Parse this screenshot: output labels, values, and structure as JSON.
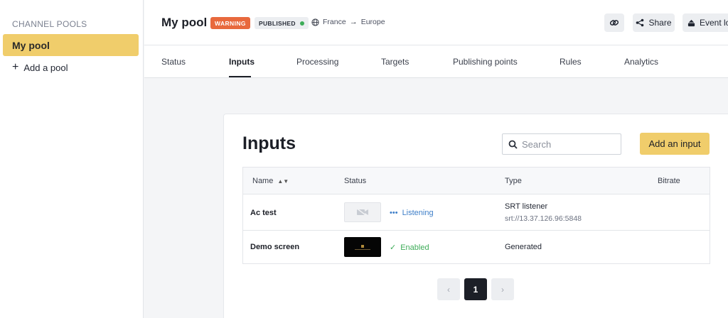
{
  "sidebar": {
    "heading": "CHANNEL POOLS",
    "items": [
      {
        "label": "My pool",
        "active": true
      }
    ],
    "add_label": "Add a pool"
  },
  "header": {
    "title": "My pool",
    "badges": {
      "warning": "WARNING",
      "published": "PUBLISHED"
    },
    "region": {
      "from": "France",
      "to": "Europe"
    },
    "buttons": {
      "share": "Share",
      "event_log": "Event log"
    }
  },
  "tabs": [
    {
      "label": "Status"
    },
    {
      "label": "Inputs",
      "active": true
    },
    {
      "label": "Processing"
    },
    {
      "label": "Targets"
    },
    {
      "label": "Publishing points"
    },
    {
      "label": "Rules"
    },
    {
      "label": "Analytics"
    }
  ],
  "main": {
    "title": "Inputs",
    "search": {
      "placeholder": "Search",
      "value": ""
    },
    "add_button": "Add an input",
    "table": {
      "columns": [
        "Name",
        "Status",
        "Type",
        "Bitrate"
      ],
      "rows": [
        {
          "name": "Ac test",
          "status": "Listening",
          "type": "SRT listener",
          "type_detail": "srt://13.37.126.96:5848",
          "bitrate": ""
        },
        {
          "name": "Demo screen",
          "status": "Enabled",
          "type": "Generated",
          "type_detail": "",
          "bitrate": ""
        }
      ]
    },
    "pagination": {
      "current_page": "1"
    }
  },
  "colors": {
    "accent": "#f0cd6b",
    "warning": "#e8693d",
    "published_dot": "#3dac58",
    "listening": "#3d7ec8",
    "enabled": "#3dac58"
  },
  "icons": [
    "plus-icon",
    "globe-icon",
    "arrow-right-icon",
    "link-icon",
    "share-icon",
    "event-log-icon",
    "search-icon",
    "sort-icon",
    "video-off-icon",
    "listening-dots-icon",
    "check-icon",
    "chevron-left-icon",
    "chevron-right-icon"
  ]
}
